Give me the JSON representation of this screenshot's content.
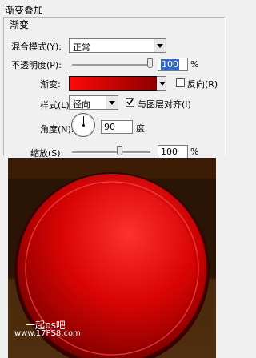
{
  "panel": {
    "title": "渐变叠加",
    "group_label": "渐变",
    "blend_mode": {
      "label": "混合模式(Y):",
      "value": "正常"
    },
    "opacity": {
      "label": "不透明度(P):",
      "value": "100",
      "unit": "%",
      "level": 1.0
    },
    "gradient": {
      "label": "渐变:",
      "reverse_label": "反向(R)",
      "reverse_checked": false,
      "colors": [
        "#ff0808",
        "#8c0000"
      ]
    },
    "style": {
      "label": "样式(L):",
      "value": "径向",
      "align_label": "与图层对齐(I)",
      "align_checked": true
    },
    "angle": {
      "label": "角度(N):",
      "value": "90",
      "unit": "度"
    },
    "scale": {
      "label": "缩放(S):",
      "value": "100",
      "unit": "%",
      "level": 0.56
    }
  },
  "watermark": {
    "line1": "一起ps吧",
    "line2": "www.17PS8.com"
  },
  "colors": {
    "panel_bg": "#f0f0f0",
    "highlight": "#316ac5",
    "button_red": "#d40000",
    "wood_dark": "#2a1405"
  },
  "icons": {
    "blend_dropdown": "chevron-down-icon",
    "gradient_dropdown": "chevron-down-icon",
    "style_dropdown": "chevron-down-icon",
    "angle_dial": "angle-dial-icon"
  }
}
